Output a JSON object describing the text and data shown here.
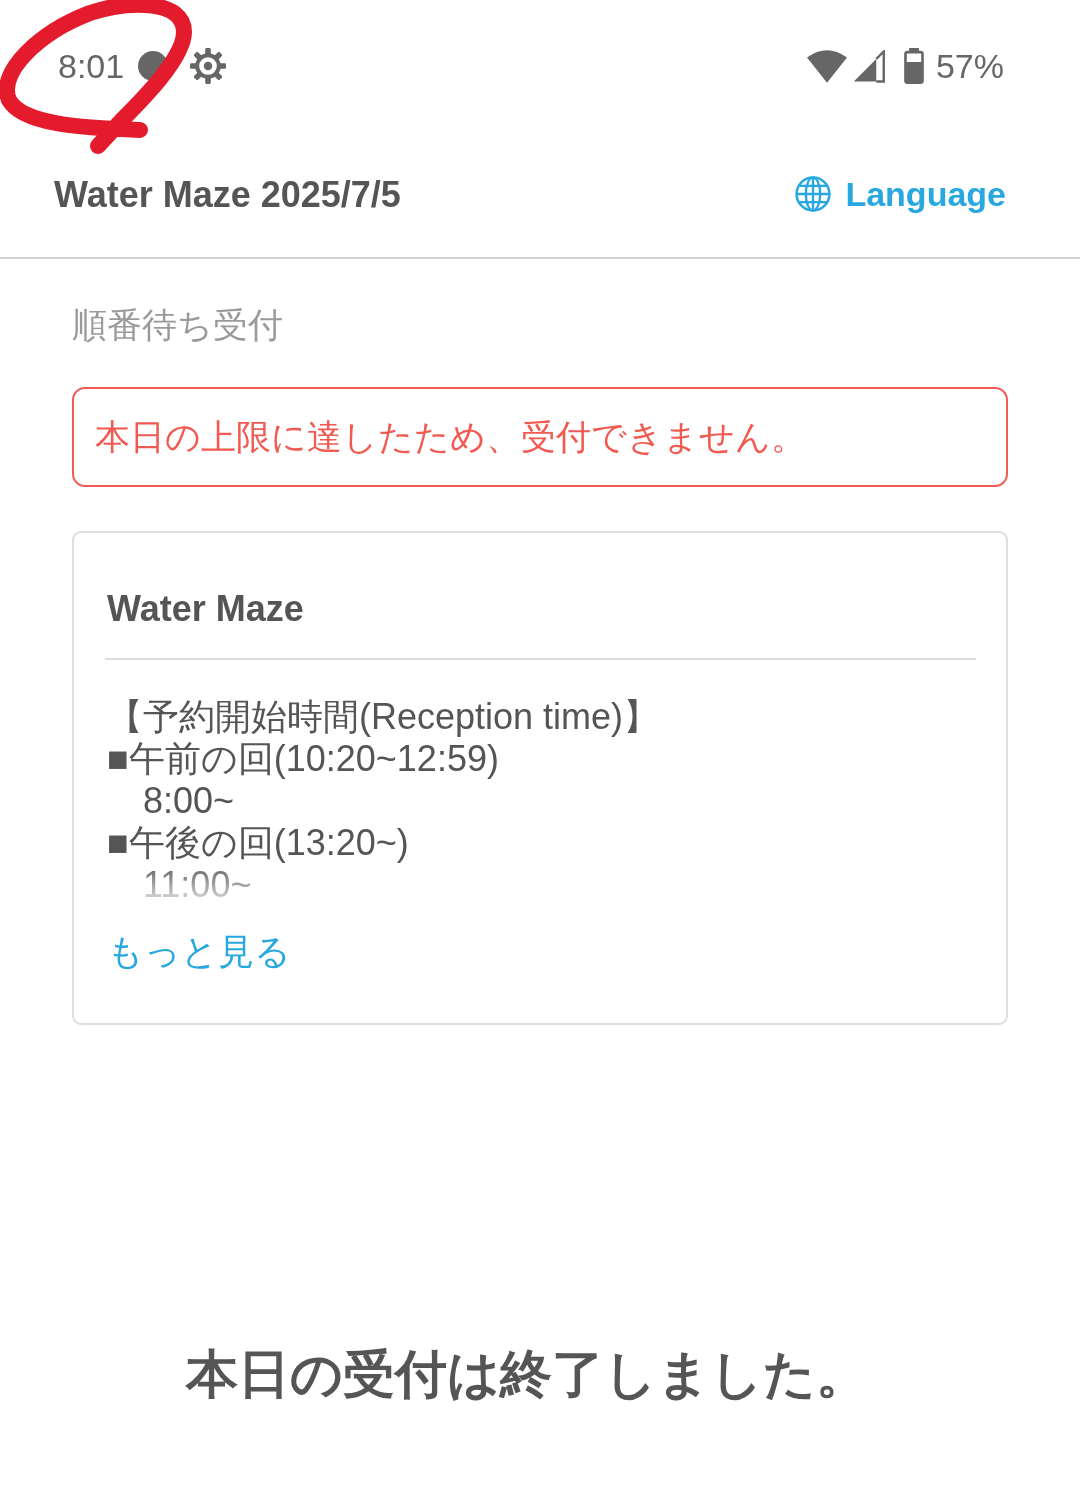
{
  "status_bar": {
    "time": "8:01",
    "battery": "57%"
  },
  "header": {
    "title": "Water Maze 2025/7/5",
    "language_link": "Language"
  },
  "section_label": "順番待ち受付",
  "alert": "本日の上限に達したため、受付できません。",
  "card": {
    "title": "Water Maze",
    "description": "【予約開始時間(Reception time)】\n■午前の回(10:20~12:59)\n　8:00~\n■午後の回(13:20~)\n　11:00~",
    "expanded": false,
    "more_link": "もっと見る"
  },
  "footer_message": "本日の受付は終了しました。"
}
